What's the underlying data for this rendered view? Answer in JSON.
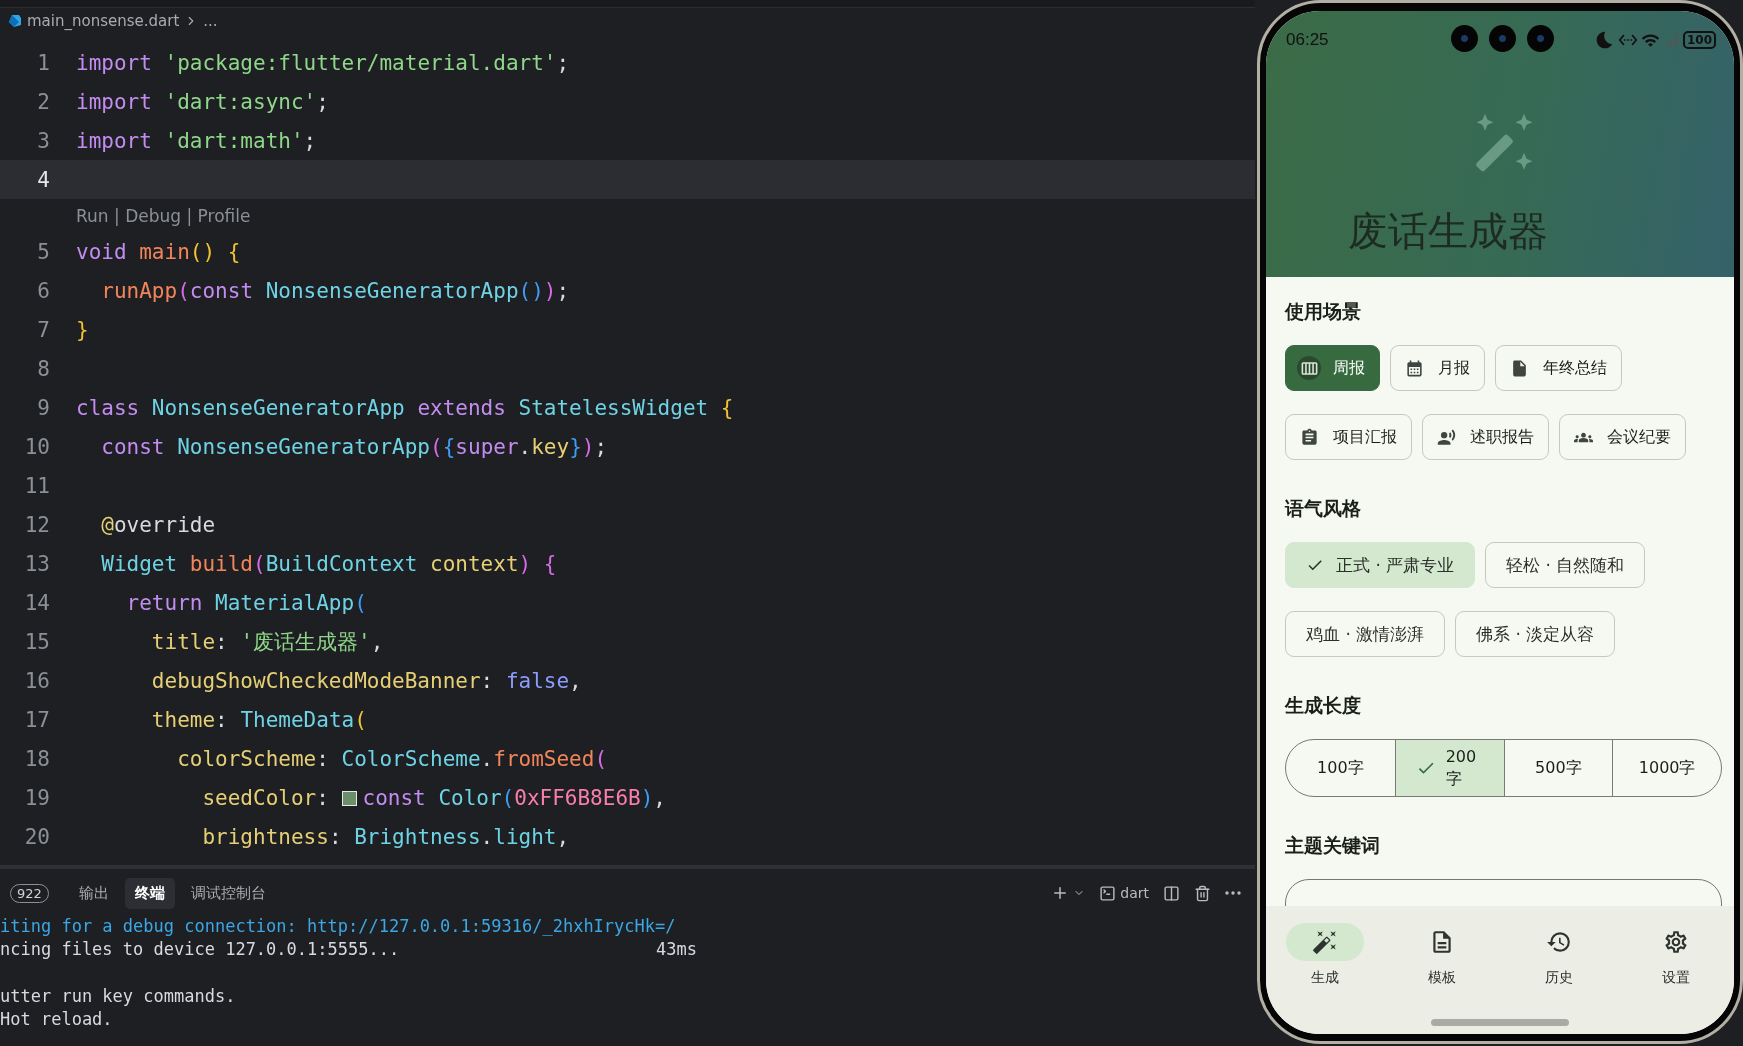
{
  "editor": {
    "breadcrumb": {
      "file": "main_nonsense.dart",
      "more": "..."
    },
    "lines": [
      {
        "number": "1",
        "current": false,
        "tokens": [
          {
            "kind": "kw",
            "text": "import "
          },
          {
            "kind": "str",
            "text": "'package:flutter/material.dart'"
          },
          {
            "kind": "plain",
            "text": ";"
          }
        ]
      },
      {
        "number": "2",
        "current": false,
        "tokens": [
          {
            "kind": "kw",
            "text": "import "
          },
          {
            "kind": "str",
            "text": "'dart:async'"
          },
          {
            "kind": "plain",
            "text": ";"
          }
        ]
      },
      {
        "number": "3",
        "current": false,
        "tokens": [
          {
            "kind": "kw",
            "text": "import "
          },
          {
            "kind": "str",
            "text": "'dart:math'"
          },
          {
            "kind": "plain",
            "text": ";"
          }
        ]
      },
      {
        "number": "4",
        "current": true,
        "code_lens": "Run | Debug | Profile"
      },
      {
        "number": "5",
        "current": false,
        "tokens": [
          {
            "kind": "kw",
            "text": "void "
          },
          {
            "kind": "fn",
            "text": "main"
          },
          {
            "kind": "b1",
            "text": "() {"
          }
        ]
      },
      {
        "number": "6",
        "current": false,
        "tokens": [
          {
            "kind": "fn",
            "text": "  runApp"
          },
          {
            "kind": "b2",
            "text": "("
          },
          {
            "kind": "kw",
            "text": "const "
          },
          {
            "kind": "type",
            "text": "NonsenseGeneratorApp"
          },
          {
            "kind": "b3",
            "text": "()"
          },
          {
            "kind": "b2",
            "text": ")"
          },
          {
            "kind": "plain",
            "text": ";"
          }
        ]
      },
      {
        "number": "7",
        "current": false,
        "tokens": [
          {
            "kind": "b1",
            "text": "}"
          }
        ]
      },
      {
        "number": "8",
        "current": false
      },
      {
        "number": "9",
        "current": false,
        "tokens": [
          {
            "kind": "kw",
            "text": "class "
          },
          {
            "kind": "type",
            "text": "NonsenseGeneratorApp "
          },
          {
            "kind": "kw",
            "text": "extends "
          },
          {
            "kind": "type",
            "text": "StatelessWidget "
          },
          {
            "kind": "b1",
            "text": "{"
          }
        ]
      },
      {
        "number": "10",
        "current": false,
        "tokens": [
          {
            "kind": "kw",
            "text": "  const "
          },
          {
            "kind": "type",
            "text": "NonsenseGeneratorApp"
          },
          {
            "kind": "b2",
            "text": "("
          },
          {
            "kind": "b3",
            "text": "{"
          },
          {
            "kind": "kw",
            "text": "super"
          },
          {
            "kind": "plain",
            "text": "."
          },
          {
            "kind": "prop",
            "text": "key"
          },
          {
            "kind": "b3",
            "text": "}"
          },
          {
            "kind": "b2",
            "text": ")"
          },
          {
            "kind": "plain",
            "text": ";"
          }
        ]
      },
      {
        "number": "11",
        "current": false
      },
      {
        "number": "12",
        "current": false,
        "tokens": [
          {
            "kind": "prop",
            "text": "  @"
          },
          {
            "kind": "plain",
            "text": "override"
          }
        ]
      },
      {
        "number": "13",
        "current": false,
        "tokens": [
          {
            "kind": "type",
            "text": "  Widget "
          },
          {
            "kind": "fn",
            "text": "build"
          },
          {
            "kind": "b2",
            "text": "("
          },
          {
            "kind": "type",
            "text": "BuildContext "
          },
          {
            "kind": "prop",
            "text": "context"
          },
          {
            "kind": "b2",
            "text": ") {"
          }
        ]
      },
      {
        "number": "14",
        "current": false,
        "tokens": [
          {
            "kind": "kw",
            "text": "    return "
          },
          {
            "kind": "type",
            "text": "MaterialApp"
          },
          {
            "kind": "b3",
            "text": "("
          }
        ]
      },
      {
        "number": "15",
        "current": false,
        "tokens": [
          {
            "kind": "prop",
            "text": "      title"
          },
          {
            "kind": "plain",
            "text": ": "
          },
          {
            "kind": "str",
            "text": "'废话生成器'"
          },
          {
            "kind": "plain",
            "text": ","
          }
        ]
      },
      {
        "number": "16",
        "current": false,
        "tokens": [
          {
            "kind": "prop",
            "text": "      debugShowCheckedModeBanner"
          },
          {
            "kind": "plain",
            "text": ": "
          },
          {
            "kind": "lit",
            "text": "false"
          },
          {
            "kind": "plain",
            "text": ","
          }
        ]
      },
      {
        "number": "17",
        "current": false,
        "tokens": [
          {
            "kind": "prop",
            "text": "      theme"
          },
          {
            "kind": "plain",
            "text": ": "
          },
          {
            "kind": "type",
            "text": "ThemeData"
          },
          {
            "kind": "b1",
            "text": "("
          }
        ]
      },
      {
        "number": "18",
        "current": false,
        "tokens": [
          {
            "kind": "prop",
            "text": "        colorScheme"
          },
          {
            "kind": "plain",
            "text": ": "
          },
          {
            "kind": "type",
            "text": "ColorScheme"
          },
          {
            "kind": "plain",
            "text": "."
          },
          {
            "kind": "fn",
            "text": "fromSeed"
          },
          {
            "kind": "b2",
            "text": "("
          }
        ]
      },
      {
        "number": "19",
        "current": false,
        "tokens": [
          {
            "kind": "prop",
            "text": "          seedColor"
          },
          {
            "kind": "plain",
            "text": ": "
          },
          {
            "kind": "swatch",
            "color": "#6b8e6b"
          },
          {
            "kind": "kw",
            "text": "const "
          },
          {
            "kind": "type",
            "text": "Color"
          },
          {
            "kind": "b3",
            "text": "("
          },
          {
            "kind": "num",
            "text": "0xFF6B8E6B"
          },
          {
            "kind": "b3",
            "text": ")"
          },
          {
            "kind": "plain",
            "text": ","
          }
        ]
      },
      {
        "number": "20",
        "current": false,
        "tokens": [
          {
            "kind": "prop",
            "text": "          brightness"
          },
          {
            "kind": "plain",
            "text": ": "
          },
          {
            "kind": "type",
            "text": "Brightness"
          },
          {
            "kind": "plain",
            "text": "."
          },
          {
            "kind": "type",
            "text": "light"
          },
          {
            "kind": "plain",
            "text": ","
          }
        ]
      }
    ]
  },
  "panel": {
    "badge": "922",
    "tabs": [
      {
        "label": "输出",
        "selected": false
      },
      {
        "label": "终端",
        "selected": true
      },
      {
        "label": "调试控制台",
        "selected": false
      }
    ],
    "shell": "dart",
    "terminal": [
      {
        "kind": "info",
        "text": "iting for a debug connection: http://127.0.0.1:59316/_2hxhIrycHk=/"
      },
      {
        "kind": "plain",
        "text": "ncing files to device 127.0.0.1:5555...",
        "time": "43ms"
      },
      {
        "kind": "blank"
      },
      {
        "kind": "plain",
        "text": "utter run key commands."
      },
      {
        "kind": "plain",
        "text": "Hot reload."
      }
    ]
  },
  "phone": {
    "status_bar": {
      "time": "06:25",
      "battery": "100"
    },
    "app_title": "废话生成器",
    "sections": [
      {
        "kind": "chips",
        "title": "使用场景",
        "options": [
          {
            "label": "周报",
            "selected": true
          },
          {
            "label": "月报",
            "selected": false
          },
          {
            "label": "年终总结",
            "selected": false
          },
          {
            "label": "项目汇报",
            "selected": false
          },
          {
            "label": "述职报告",
            "selected": false
          },
          {
            "label": "会议纪要",
            "selected": false
          }
        ]
      },
      {
        "kind": "filter",
        "title": "语气风格",
        "options": [
          {
            "label": "正式 · 严肃专业",
            "selected": true
          },
          {
            "label": "轻松 · 自然随和",
            "selected": false
          },
          {
            "label": "鸡血 · 激情澎湃",
            "selected": false
          },
          {
            "label": "佛系 · 淡定从容",
            "selected": false
          }
        ]
      },
      {
        "kind": "segmented",
        "title": "生成长度",
        "options": [
          {
            "label": "100字",
            "selected": false
          },
          {
            "label": "200字",
            "selected": true
          },
          {
            "label": "500字",
            "selected": false
          },
          {
            "label": "1000字",
            "selected": false
          }
        ]
      },
      {
        "kind": "field",
        "title": "主题关键词"
      }
    ],
    "nav": [
      {
        "label": "生成",
        "selected": true
      },
      {
        "label": "模板",
        "selected": false
      },
      {
        "label": "历史",
        "selected": false
      },
      {
        "label": "设置",
        "selected": false
      }
    ]
  }
}
